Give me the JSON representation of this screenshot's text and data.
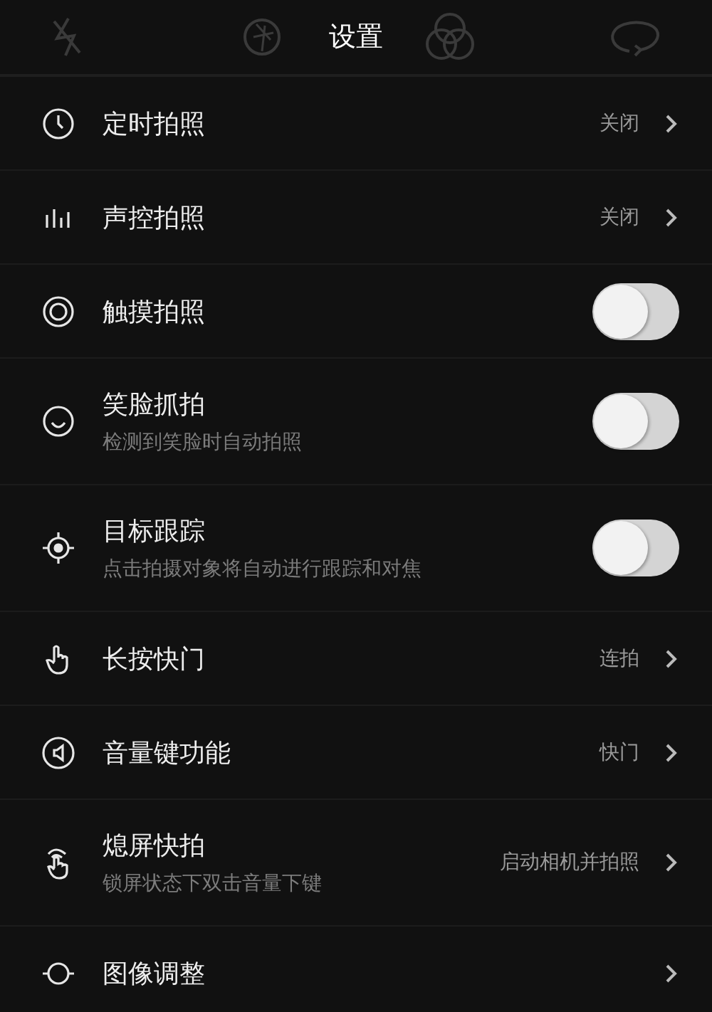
{
  "header": {
    "title": "设置"
  },
  "settings": [
    {
      "kind": "nav",
      "label": "定时拍照",
      "value": "关闭"
    },
    {
      "kind": "nav",
      "label": "声控拍照",
      "value": "关闭"
    },
    {
      "kind": "toggle",
      "label": "触摸拍照",
      "on": false
    },
    {
      "kind": "toggle",
      "label": "笑脸抓拍",
      "subtitle": "检测到笑脸时自动拍照",
      "on": false
    },
    {
      "kind": "toggle",
      "label": "目标跟踪",
      "subtitle": "点击拍摄对象将自动进行跟踪和对焦",
      "on": false
    },
    {
      "kind": "nav",
      "label": "长按快门",
      "value": "连拍"
    },
    {
      "kind": "nav",
      "label": "音量键功能",
      "value": "快门"
    },
    {
      "kind": "nav",
      "label": "熄屏快拍",
      "subtitle": "锁屏状态下双击音量下键",
      "value": "启动相机并拍照"
    },
    {
      "kind": "nav",
      "label": "图像调整"
    }
  ]
}
